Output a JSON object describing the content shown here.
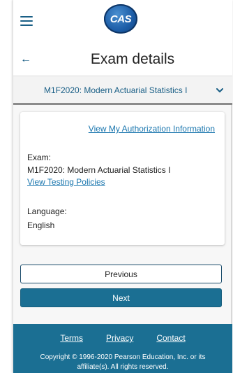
{
  "header": {
    "logo_text": "CAS",
    "menu_icon": "hamburger-menu-icon"
  },
  "title_bar": {
    "back_icon": "back-arrow-icon",
    "back_glyph": "←",
    "title": "Exam details"
  },
  "exam_select": {
    "selected": "M1F2020: Modern Actuarial Statistics I",
    "chevron_icon": "chevron-down-icon"
  },
  "card": {
    "auth_link": "View My Authorization Information",
    "exam_label": "Exam:",
    "exam_value": "M1F2020: Modern Actuarial Statistics I",
    "policies_link": "View Testing Policies",
    "language_label": "Language:",
    "language_value": "English"
  },
  "buttons": {
    "previous": "Previous",
    "next": "Next"
  },
  "footer": {
    "links": [
      "Terms",
      "Privacy",
      "Contact"
    ],
    "copyright_line1": "Copyright © 1996-2020 Pearson Education, Inc. or its",
    "copyright_line2": "affiliate(s). All rights reserved."
  },
  "colors": {
    "accent": "#1b6f93",
    "link": "#1a76ae",
    "nav_blue": "#1a5f86"
  }
}
